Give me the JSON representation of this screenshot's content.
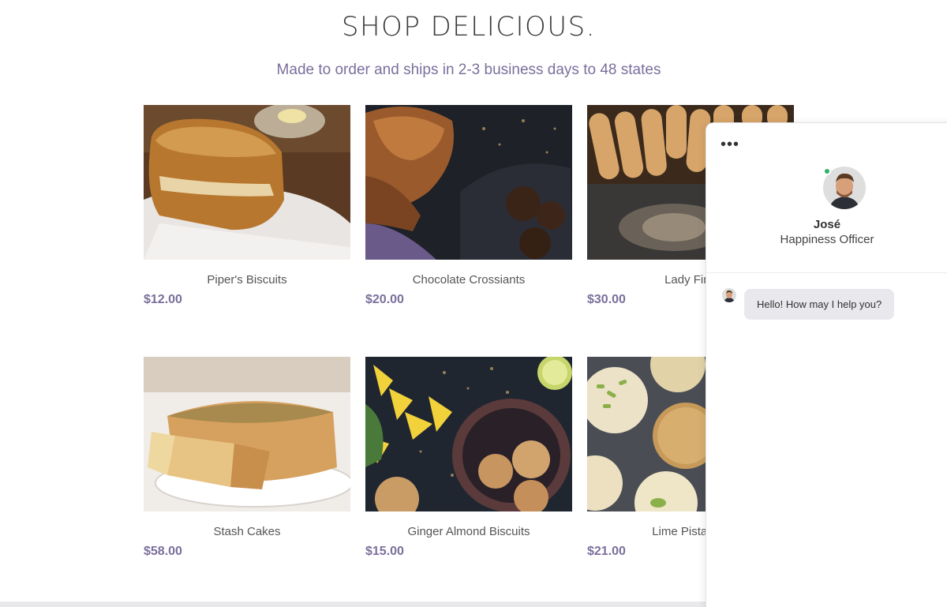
{
  "header": {
    "title": "SHOP DELICIOUS.",
    "subtitle": "Made to order and ships in 2-3 business days to 48 states"
  },
  "products": [
    {
      "name": "Piper's Biscuits",
      "price": "$12.00"
    },
    {
      "name": "Chocolate Crossiants",
      "price": "$20.00"
    },
    {
      "name": "Lady Fing",
      "price": "$30.00"
    },
    {
      "name": "Stash Cakes",
      "price": "$58.00"
    },
    {
      "name": "Ginger Almond Biscuits",
      "price": "$15.00"
    },
    {
      "name": "Lime Pistachio",
      "price": "$21.00"
    }
  ],
  "chat": {
    "menu_icon": "more-horizontal-icon",
    "agent_name": "José",
    "agent_role": "Happiness Officer",
    "status_color": "#2db36a",
    "messages": [
      {
        "text": "Hello! How may I help you?"
      }
    ]
  },
  "colors": {
    "accent": "#7b6f9c",
    "title": "#3a3a3a"
  }
}
